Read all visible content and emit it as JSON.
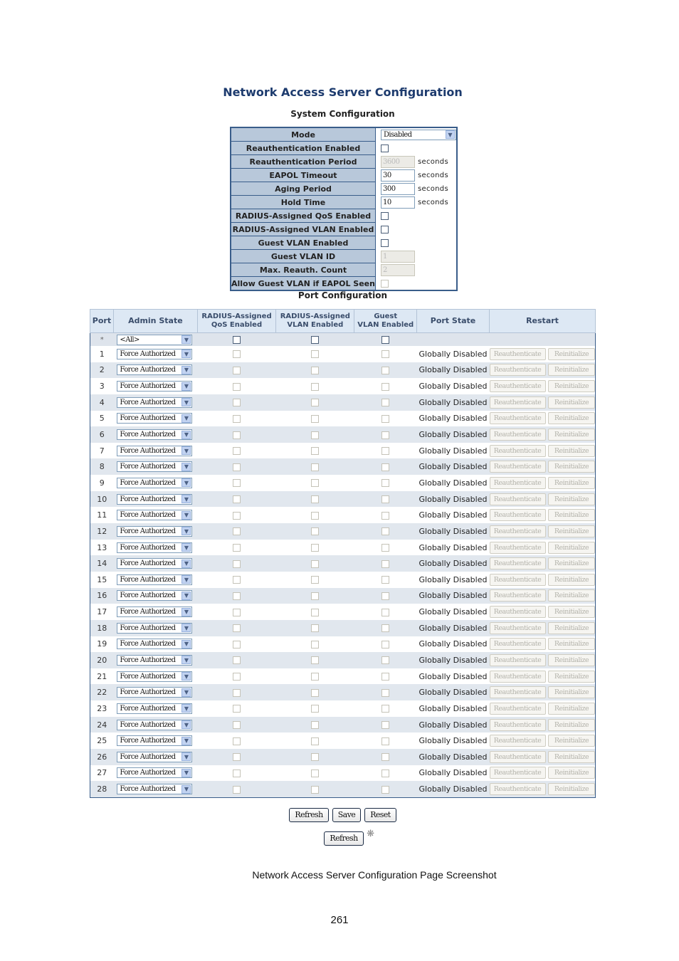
{
  "title": "Network Access Server Configuration",
  "system": {
    "heading": "System Configuration",
    "mode": {
      "label": "Mode",
      "value": "Disabled"
    },
    "reauth_enabled": {
      "label": "Reauthentication Enabled",
      "checked": false
    },
    "reauth_period": {
      "label": "Reauthentication Period",
      "value": "3600",
      "unit": "seconds"
    },
    "eapol_timeout": {
      "label": "EAPOL Timeout",
      "value": "30",
      "unit": "seconds"
    },
    "aging_period": {
      "label": "Aging Period",
      "value": "300",
      "unit": "seconds"
    },
    "hold_time": {
      "label": "Hold Time",
      "value": "10",
      "unit": "seconds"
    },
    "radius_qos": {
      "label": "RADIUS-Assigned QoS Enabled",
      "checked": false
    },
    "radius_vlan": {
      "label": "RADIUS-Assigned VLAN Enabled",
      "checked": false
    },
    "guest_vlan_enabled": {
      "label": "Guest VLAN Enabled",
      "checked": false
    },
    "guest_vlan_id": {
      "label": "Guest VLAN ID",
      "value": "1"
    },
    "max_reauth": {
      "label": "Max. Reauth. Count",
      "value": "2"
    },
    "allow_guest": {
      "label": "Allow Guest VLAN if EAPOL Seen",
      "checked": false
    }
  },
  "ports": {
    "heading": "Port Configuration",
    "columns": {
      "port": "Port",
      "admin_state": "Admin State",
      "qos_1": "RADIUS-Assigned",
      "qos_2": "QoS Enabled",
      "vlan_1": "RADIUS-Assigned",
      "vlan_2": "VLAN Enabled",
      "guest_1": "Guest",
      "guest_2": "VLAN Enabled",
      "port_state": "Port State",
      "restart": "Restart"
    },
    "all_row": {
      "port": "*",
      "admin_state": "<All>"
    },
    "admin_state_value": "Force Authorized",
    "port_state_value": "Globally Disabled",
    "reauth_label": "Reauthenticate",
    "reinit_label": "Reinitialize",
    "rows": [
      "1",
      "2",
      "3",
      "4",
      "5",
      "6",
      "7",
      "8",
      "9",
      "10",
      "11",
      "12",
      "13",
      "14",
      "15",
      "16",
      "17",
      "18",
      "19",
      "20",
      "21",
      "22",
      "23",
      "24",
      "25",
      "26",
      "27",
      "28"
    ]
  },
  "buttons": {
    "refresh": "Refresh",
    "save": "Save",
    "reset": "Reset",
    "refresh2": "Refresh"
  },
  "caption": "Network Access Server Configuration Page Screenshot",
  "page_number": "261"
}
